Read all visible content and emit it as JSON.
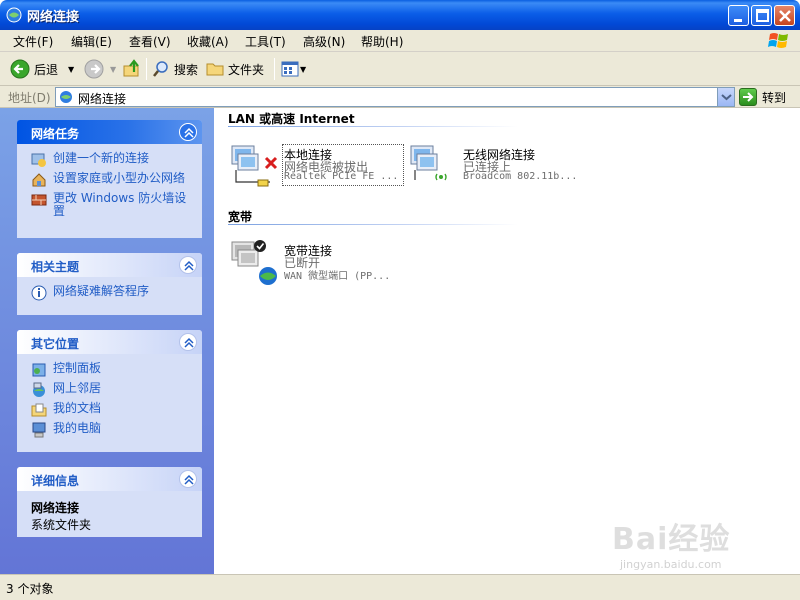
{
  "window": {
    "title": "网络连接"
  },
  "menu": {
    "items": [
      "文件(F)",
      "编辑(E)",
      "查看(V)",
      "收藏(A)",
      "工具(T)",
      "高级(N)",
      "帮助(H)"
    ]
  },
  "toolbar": {
    "back": "后退",
    "search": "搜索",
    "folders": "文件夹"
  },
  "address": {
    "label": "地址(D)",
    "value": "网络连接",
    "go": "转到"
  },
  "sidebar": {
    "network_tasks": {
      "title": "网络任务",
      "items": [
        "创建一个新的连接",
        "设置家庭或小型办公网络",
        "更改 Windows 防火墙设置"
      ]
    },
    "related": {
      "title": "相关主题",
      "items": [
        "网络疑难解答程序"
      ]
    },
    "other_places": {
      "title": "其它位置",
      "items": [
        "控制面板",
        "网上邻居",
        "我的文档",
        "我的电脑"
      ]
    },
    "details": {
      "title": "详细信息",
      "name": "网络连接",
      "type": "系统文件夹"
    }
  },
  "groups": [
    {
      "title": "LAN 或高速 Internet",
      "connections": [
        {
          "name": "本地连接",
          "status": "网络电缆被拔出",
          "device": "Realtek PCIe FE ..."
        },
        {
          "name": "无线网络连接",
          "status": "已连接上",
          "device": "Broadcom 802.11b..."
        }
      ]
    },
    {
      "title": "宽带",
      "connections": [
        {
          "name": "宽带连接",
          "status": "已断开",
          "device": "WAN 微型端口 (PP..."
        }
      ]
    }
  ],
  "statusbar": {
    "text": "3 个对象"
  },
  "watermark": {
    "main": "Bai经验",
    "sub": "jingyan.baidu.com"
  }
}
